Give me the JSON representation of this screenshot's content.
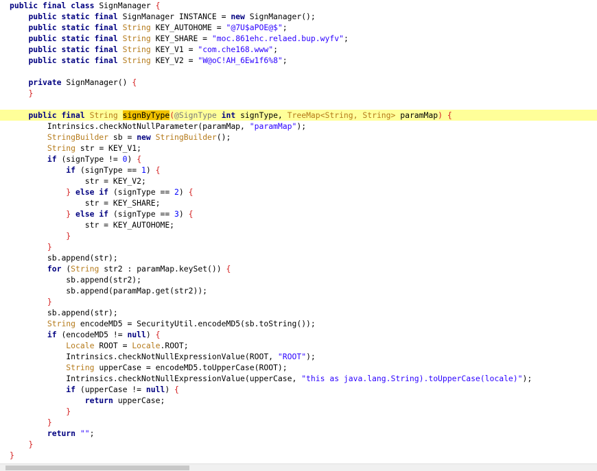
{
  "editor": {
    "language": "java",
    "highlighted_line": 10,
    "colors": {
      "keyword": "#000080",
      "type": "#b57a1a",
      "string": "#2a00ff",
      "number": "#0000ff",
      "annotation": "#7a7a7a",
      "brace": "#d42020",
      "line_highlight": "#ffff99",
      "selection_mark": "#f2c200"
    },
    "lines": [
      [
        [
          "public final class ",
          "kw"
        ],
        [
          "SignManager ",
          "id"
        ],
        [
          "{",
          "br"
        ]
      ],
      [
        [
          "    ",
          "id"
        ],
        [
          "public static final ",
          "kw"
        ],
        [
          "SignManager INSTANCE = ",
          "id"
        ],
        [
          "new ",
          "kw"
        ],
        [
          "SignManager();",
          "id"
        ]
      ],
      [
        [
          "    ",
          "id"
        ],
        [
          "public static final ",
          "kw"
        ],
        [
          "String ",
          "type"
        ],
        [
          "KEY_AUTOHOME = ",
          "id"
        ],
        [
          "\"@7U$aPOE@$\"",
          "str"
        ],
        [
          ";",
          "id"
        ]
      ],
      [
        [
          "    ",
          "id"
        ],
        [
          "public static final ",
          "kw"
        ],
        [
          "String ",
          "type"
        ],
        [
          "KEY_SHARE = ",
          "id"
        ],
        [
          "\"moc.861ehc.relaed.bup.wyfv\"",
          "str"
        ],
        [
          ";",
          "id"
        ]
      ],
      [
        [
          "    ",
          "id"
        ],
        [
          "public static final ",
          "kw"
        ],
        [
          "String ",
          "type"
        ],
        [
          "KEY_V1 = ",
          "id"
        ],
        [
          "\"com.che168.www\"",
          "str"
        ],
        [
          ";",
          "id"
        ]
      ],
      [
        [
          "    ",
          "id"
        ],
        [
          "public static final ",
          "kw"
        ],
        [
          "String ",
          "type"
        ],
        [
          "KEY_V2 = ",
          "id"
        ],
        [
          "\"W@oC!AH_6Ew1f6%8\"",
          "str"
        ],
        [
          ";",
          "id"
        ]
      ],
      [],
      [
        [
          "    ",
          "id"
        ],
        [
          "private ",
          "kw"
        ],
        [
          "SignManager() ",
          "id"
        ],
        [
          "{",
          "br"
        ]
      ],
      [
        [
          "    ",
          "id"
        ],
        [
          "}",
          "br"
        ]
      ],
      [],
      [
        [
          "    ",
          "id"
        ],
        [
          "public final ",
          "kw"
        ],
        [
          "String ",
          "type"
        ],
        [
          "signByType",
          "mark"
        ],
        [
          "(",
          "br"
        ],
        [
          "@SignType ",
          "ann"
        ],
        [
          "int ",
          "kw"
        ],
        [
          "signType, ",
          "id"
        ],
        [
          "TreeMap<String, String> ",
          "type"
        ],
        [
          "paramMap",
          "id"
        ],
        [
          ") {",
          "br"
        ]
      ],
      [
        [
          "        ",
          "id"
        ],
        [
          "Intrinsics.checkNotNullParameter(paramMap, ",
          "id"
        ],
        [
          "\"paramMap\"",
          "str"
        ],
        [
          ");",
          "id"
        ]
      ],
      [
        [
          "        ",
          "id"
        ],
        [
          "StringBuilder ",
          "type"
        ],
        [
          "sb = ",
          "id"
        ],
        [
          "new ",
          "kw"
        ],
        [
          "StringBuilder",
          "type"
        ],
        [
          "();",
          "id"
        ]
      ],
      [
        [
          "        ",
          "id"
        ],
        [
          "String ",
          "type"
        ],
        [
          "str = KEY_V1;",
          "id"
        ]
      ],
      [
        [
          "        ",
          "id"
        ],
        [
          "if ",
          "kw"
        ],
        [
          "(signType != ",
          "id"
        ],
        [
          "0",
          "num"
        ],
        [
          ") ",
          "id"
        ],
        [
          "{",
          "br"
        ]
      ],
      [
        [
          "            ",
          "id"
        ],
        [
          "if ",
          "kw"
        ],
        [
          "(signType == ",
          "id"
        ],
        [
          "1",
          "num"
        ],
        [
          ") ",
          "id"
        ],
        [
          "{",
          "br"
        ]
      ],
      [
        [
          "                ",
          "id"
        ],
        [
          "str = KEY_V2;",
          "id"
        ]
      ],
      [
        [
          "            ",
          "id"
        ],
        [
          "} ",
          "br"
        ],
        [
          "else if ",
          "kw"
        ],
        [
          "(signType == ",
          "id"
        ],
        [
          "2",
          "num"
        ],
        [
          ") ",
          "id"
        ],
        [
          "{",
          "br"
        ]
      ],
      [
        [
          "                ",
          "id"
        ],
        [
          "str = KEY_SHARE;",
          "id"
        ]
      ],
      [
        [
          "            ",
          "id"
        ],
        [
          "} ",
          "br"
        ],
        [
          "else if ",
          "kw"
        ],
        [
          "(signType == ",
          "id"
        ],
        [
          "3",
          "num"
        ],
        [
          ") ",
          "id"
        ],
        [
          "{",
          "br"
        ]
      ],
      [
        [
          "                ",
          "id"
        ],
        [
          "str = KEY_AUTOHOME;",
          "id"
        ]
      ],
      [
        [
          "            ",
          "id"
        ],
        [
          "}",
          "br"
        ]
      ],
      [
        [
          "        ",
          "id"
        ],
        [
          "}",
          "br"
        ]
      ],
      [
        [
          "        ",
          "id"
        ],
        [
          "sb.append(str);",
          "id"
        ]
      ],
      [
        [
          "        ",
          "id"
        ],
        [
          "for ",
          "kw"
        ],
        [
          "(",
          "id"
        ],
        [
          "String ",
          "type"
        ],
        [
          "str2 : paramMap.keySet()) ",
          "id"
        ],
        [
          "{",
          "br"
        ]
      ],
      [
        [
          "            ",
          "id"
        ],
        [
          "sb.append(str2);",
          "id"
        ]
      ],
      [
        [
          "            ",
          "id"
        ],
        [
          "sb.append(paramMap.get(str2));",
          "id"
        ]
      ],
      [
        [
          "        ",
          "id"
        ],
        [
          "}",
          "br"
        ]
      ],
      [
        [
          "        ",
          "id"
        ],
        [
          "sb.append(str);",
          "id"
        ]
      ],
      [
        [
          "        ",
          "id"
        ],
        [
          "String ",
          "type"
        ],
        [
          "encodeMD5 = SecurityUtil.encodeMD5(sb.toString());",
          "id"
        ]
      ],
      [
        [
          "        ",
          "id"
        ],
        [
          "if ",
          "kw"
        ],
        [
          "(encodeMD5 != ",
          "id"
        ],
        [
          "null",
          "kw"
        ],
        [
          ") ",
          "id"
        ],
        [
          "{",
          "br"
        ]
      ],
      [
        [
          "            ",
          "id"
        ],
        [
          "Locale ",
          "type"
        ],
        [
          "ROOT = ",
          "id"
        ],
        [
          "Locale",
          "type"
        ],
        [
          ".ROOT;",
          "id"
        ]
      ],
      [
        [
          "            ",
          "id"
        ],
        [
          "Intrinsics.checkNotNullExpressionValue(ROOT, ",
          "id"
        ],
        [
          "\"ROOT\"",
          "str"
        ],
        [
          ");",
          "id"
        ]
      ],
      [
        [
          "            ",
          "id"
        ],
        [
          "String ",
          "type"
        ],
        [
          "upperCase = encodeMD5.toUpperCase(ROOT);",
          "id"
        ]
      ],
      [
        [
          "            ",
          "id"
        ],
        [
          "Intrinsics.checkNotNullExpressionValue(upperCase, ",
          "id"
        ],
        [
          "\"this as java.lang.String).toUpperCase(locale)\"",
          "str"
        ],
        [
          ");",
          "id"
        ]
      ],
      [
        [
          "            ",
          "id"
        ],
        [
          "if ",
          "kw"
        ],
        [
          "(upperCase != ",
          "id"
        ],
        [
          "null",
          "kw"
        ],
        [
          ") ",
          "id"
        ],
        [
          "{",
          "br"
        ]
      ],
      [
        [
          "                ",
          "id"
        ],
        [
          "return ",
          "kw"
        ],
        [
          "upperCase;",
          "id"
        ]
      ],
      [
        [
          "            ",
          "id"
        ],
        [
          "}",
          "br"
        ]
      ],
      [
        [
          "        ",
          "id"
        ],
        [
          "}",
          "br"
        ]
      ],
      [
        [
          "        ",
          "id"
        ],
        [
          "return ",
          "kw"
        ],
        [
          "\"\"",
          "str"
        ],
        [
          ";",
          "id"
        ]
      ],
      [
        [
          "    ",
          "id"
        ],
        [
          "}",
          "br"
        ]
      ],
      [
        [
          "}",
          "br"
        ]
      ]
    ]
  },
  "scrollbar": {
    "orientation": "horizontal"
  }
}
